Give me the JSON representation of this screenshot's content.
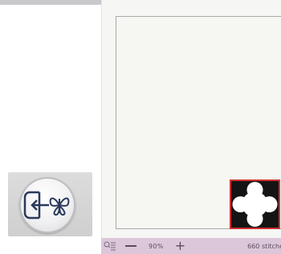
{
  "statusbar": {
    "zoom_level": "90%",
    "stitch_count": "660 stitche"
  },
  "icons": {
    "import_design": "import-butterfly-icon",
    "zoom": "zoom-list-icon",
    "zoom_out": "minus-icon",
    "zoom_in": "plus-icon",
    "design": "embroidery-design-icon"
  },
  "colors": {
    "statusbar_bg": "#dcc7da",
    "selection_border": "#d03030",
    "hoop_border": "#a6a8ac",
    "canvas_bg": "#f6f6f4"
  }
}
